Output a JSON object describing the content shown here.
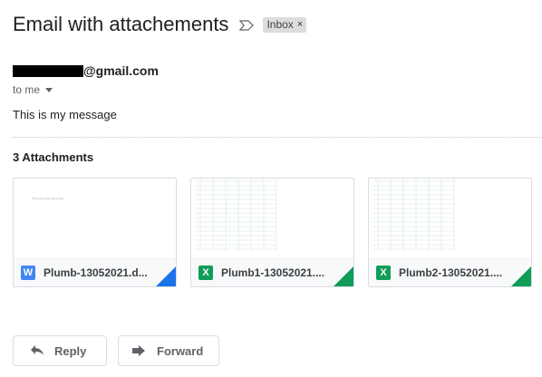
{
  "subject": "Email with attachements",
  "label": "Inbox",
  "label_close": "×",
  "sender_visible": "@gmail.com",
  "to_text": "to me",
  "message_body": "This is my message",
  "attachments_heading": "3 Attachments",
  "attachments": [
    {
      "name": "Plumb-13052021.d...",
      "type": "docx",
      "badge": "W",
      "color": "#4285f4",
      "fold_color": "#1a73e8",
      "preview_text": "This is the word document"
    },
    {
      "name": "Plumb1-13052021....",
      "type": "xlsx",
      "badge": "X",
      "color": "#0f9d58",
      "fold_color": "#0f9d58"
    },
    {
      "name": "Plumb2-13052021....",
      "type": "xlsx",
      "badge": "X",
      "color": "#0f9d58",
      "fold_color": "#0f9d58"
    }
  ],
  "actions": {
    "reply": "Reply",
    "forward": "Forward"
  },
  "icons": {
    "important": "important-marker-icon",
    "reply": "reply-arrow-icon",
    "forward": "forward-arrow-icon"
  }
}
